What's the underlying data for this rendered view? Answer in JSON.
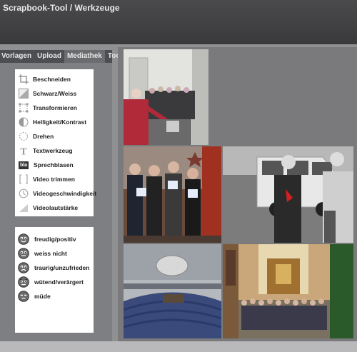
{
  "window": {
    "title": "Scrapbook-Tool / Werkzeuge"
  },
  "tabs": [
    {
      "label": "Vorlagen"
    },
    {
      "label": "Upload"
    },
    {
      "label": "Mediathek"
    },
    {
      "label": "Tools"
    }
  ],
  "tools": [
    {
      "label": "Beschneiden",
      "icon": "crop-icon"
    },
    {
      "label": "Schwarz/Weiss",
      "icon": "black-white-icon"
    },
    {
      "label": "Transformieren",
      "icon": "transform-icon"
    },
    {
      "label": "Helligkeit/Kontrast",
      "icon": "brightness-contrast-icon"
    },
    {
      "label": "Drehen",
      "icon": "rotate-icon"
    },
    {
      "label": "Textwerkzeug",
      "icon": "text-tool-icon"
    },
    {
      "label": "Sprechblasen",
      "icon": "speech-bubble-icon",
      "badge": "bla"
    },
    {
      "label": "Video trimmen",
      "icon": "video-trim-icon"
    },
    {
      "label": "Videogeschwindigkeit",
      "icon": "video-speed-icon"
    },
    {
      "label": "Videolautstärke",
      "icon": "video-volume-icon"
    }
  ],
  "moods": [
    {
      "label": "freudig/positiv",
      "icon": "happy-face-icon"
    },
    {
      "label": "weiss nicht",
      "icon": "neutral-face-icon"
    },
    {
      "label": "traurig/unzufrieden",
      "icon": "sad-face-icon"
    },
    {
      "label": "wütend/verärgert",
      "icon": "angry-face-icon"
    },
    {
      "label": "müde",
      "icon": "tired-face-icon"
    }
  ],
  "colors": {
    "titlebar": "#3e3e40",
    "tab_active": "#6b6c70",
    "panel": "#7e7f83",
    "box": "#ffffff",
    "accent_red": "#d42020"
  }
}
